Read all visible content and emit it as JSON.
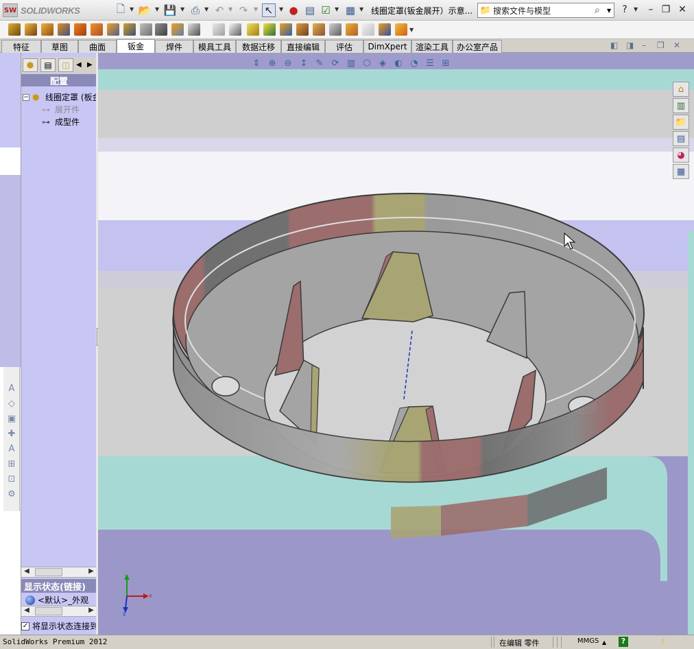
{
  "app": {
    "brand": "SOLIDWORKS",
    "brand_mark": "SW"
  },
  "title": {
    "document": "线圈定罩(钣金展开）示意...",
    "search_placeholder": "搜索文件与模型",
    "help": "?"
  },
  "tabs": [
    "特征",
    "草图",
    "曲面",
    "钣金",
    "焊件",
    "模具工具",
    "数据迁移",
    "直接编辑",
    "评估",
    "DimXpert",
    "渲染工具",
    "办公室产品"
  ],
  "active_tab": "钣金",
  "feature_manager": {
    "config_header": "配置",
    "tree": [
      {
        "label": "线圈定罩 (板金",
        "state": "root"
      },
      {
        "label": "展开件",
        "state": "suppressed"
      },
      {
        "label": "成型件",
        "state": "active"
      }
    ],
    "display_state_header": "显示状态(链接)",
    "display_state_item": "<默认>_外观",
    "link_checkbox_label": "将显示状态连接到"
  },
  "status_bar": {
    "product": "SolidWorks Premium 2012",
    "mode": "在编辑 零件",
    "units": "MMGS",
    "help": "?"
  },
  "triad": {
    "x": "X",
    "y": "Y",
    "z": "Z"
  },
  "colors": {
    "background_purple": "#9b98c9",
    "teal": "#a7d9d4",
    "part_gray": "#a4a4a4",
    "face_red": "#9b6d6d",
    "face_olive": "#a8a474",
    "panel_lavender": "#c8c6f5"
  },
  "icons": {
    "task_pane": [
      "home-icon",
      "library-icon",
      "folder-icon",
      "view-palette-icon",
      "appearance-icon",
      "custom-props-icon"
    ]
  }
}
